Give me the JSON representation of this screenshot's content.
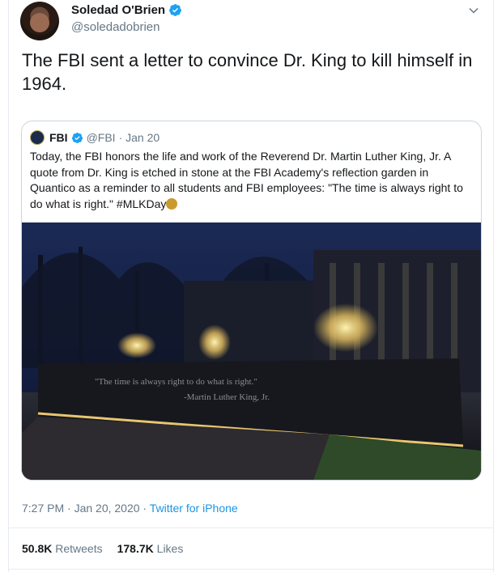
{
  "author": {
    "name": "Soledad O'Brien",
    "handle": "@soledadobrien"
  },
  "tweet": {
    "text": "The FBI sent a letter to convince Dr. King to kill himself in 1964."
  },
  "quoted_tweet": {
    "name": "FBI",
    "handle": "@FBI",
    "date": "· Jan 20",
    "text": "Today, the FBI honors the life and work of the Reverend Dr. Martin Luther King, Jr. A quote from Dr. King is etched in stone at the FBI Academy's reflection garden in Quantico as a reminder to all students and FBI employees: \"The time is always right to do what is right.\" #MLKDay",
    "photo_quote": "\"The time is always right to do what is right.\"",
    "photo_attribution": "-Martin Luther King, Jr."
  },
  "meta": {
    "time_date": "7:27 PM · Jan 20, 2020 · ",
    "source": "Twitter for iPhone"
  },
  "stats": {
    "retweets_count": "50.8K",
    "retweets_label": "Retweets",
    "likes_count": "178.7K",
    "likes_label": "Likes"
  },
  "icons": [
    "verified-badge-icon",
    "chevron-down-icon",
    "sparkles-emoji-icon"
  ],
  "colors": {
    "verified": "#1da1f2",
    "link": "#1b95e0",
    "muted": "#657786"
  }
}
